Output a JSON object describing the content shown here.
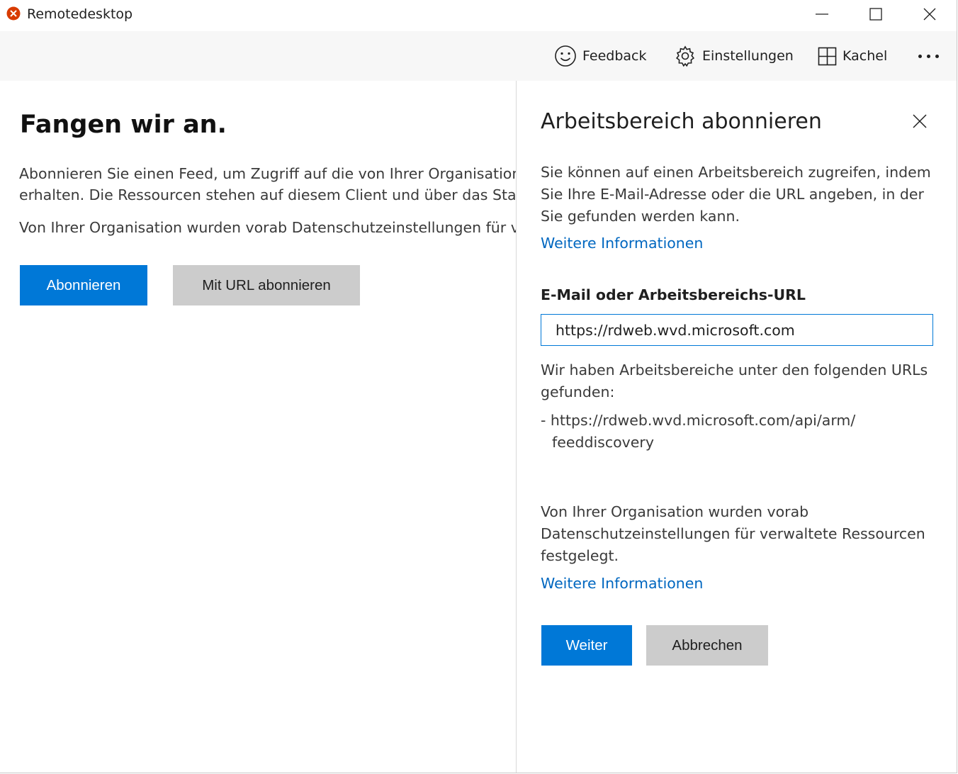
{
  "window": {
    "title": "Remotedesktop"
  },
  "toolbar": {
    "feedback_label": "Feedback",
    "settings_label": "Einstellungen",
    "tile_label": "Kachel"
  },
  "main": {
    "heading": "Fangen wir an.",
    "intro_line1": "Abonnieren Sie einen Feed, um Zugriff auf die von Ihrer Organisation",
    "intro_line2": "erhalten. Die Ressourcen stehen auf diesem Client und über das Startr",
    "privacy_text": "Von Ihrer Organisation wurden vorab Datenschutzeinstellungen für ve",
    "subscribe_label": "Abonnieren",
    "subscribe_url_label": "Mit URL abonnieren"
  },
  "pane": {
    "title": "Arbeitsbereich abonnieren",
    "description_line1": "Sie können auf einen Arbeitsbereich zugreifen, indem",
    "description_line2": "Sie Ihre E-Mail-Adresse oder die URL angeben, in der",
    "description_line3": "Sie gefunden werden kann.",
    "more_info_label": "Weitere Informationen",
    "field_label": "E-Mail oder Arbeitsbereichs-URL",
    "field_value": "https://rdweb.wvd.microsoft.com",
    "found_line1": "Wir haben Arbeitsbereiche unter den folgenden URLs",
    "found_line2": "gefunden:",
    "found_url_line1": "- https://rdweb.wvd.microsoft.com/api/arm/",
    "found_url_line2": "feeddiscovery",
    "privacy_line1": "Von Ihrer Organisation wurden vorab",
    "privacy_line2": "Datenschutzeinstellungen für verwaltete Ressourcen",
    "privacy_line3": "festgelegt.",
    "more_info_label2": "Weitere Informationen",
    "next_label": "Weiter",
    "cancel_label": "Abbrechen"
  },
  "colors": {
    "accent": "#0078d7",
    "link": "#0067c0",
    "secondary_button": "#cccccc",
    "toolbar_bg": "#f7f7f7"
  },
  "icons": {
    "app": "remote-desktop-icon",
    "feedback": "smiley-icon",
    "settings": "gear-icon",
    "tile": "tile-grid-icon",
    "more": "more-dots-icon",
    "close": "close-icon"
  }
}
